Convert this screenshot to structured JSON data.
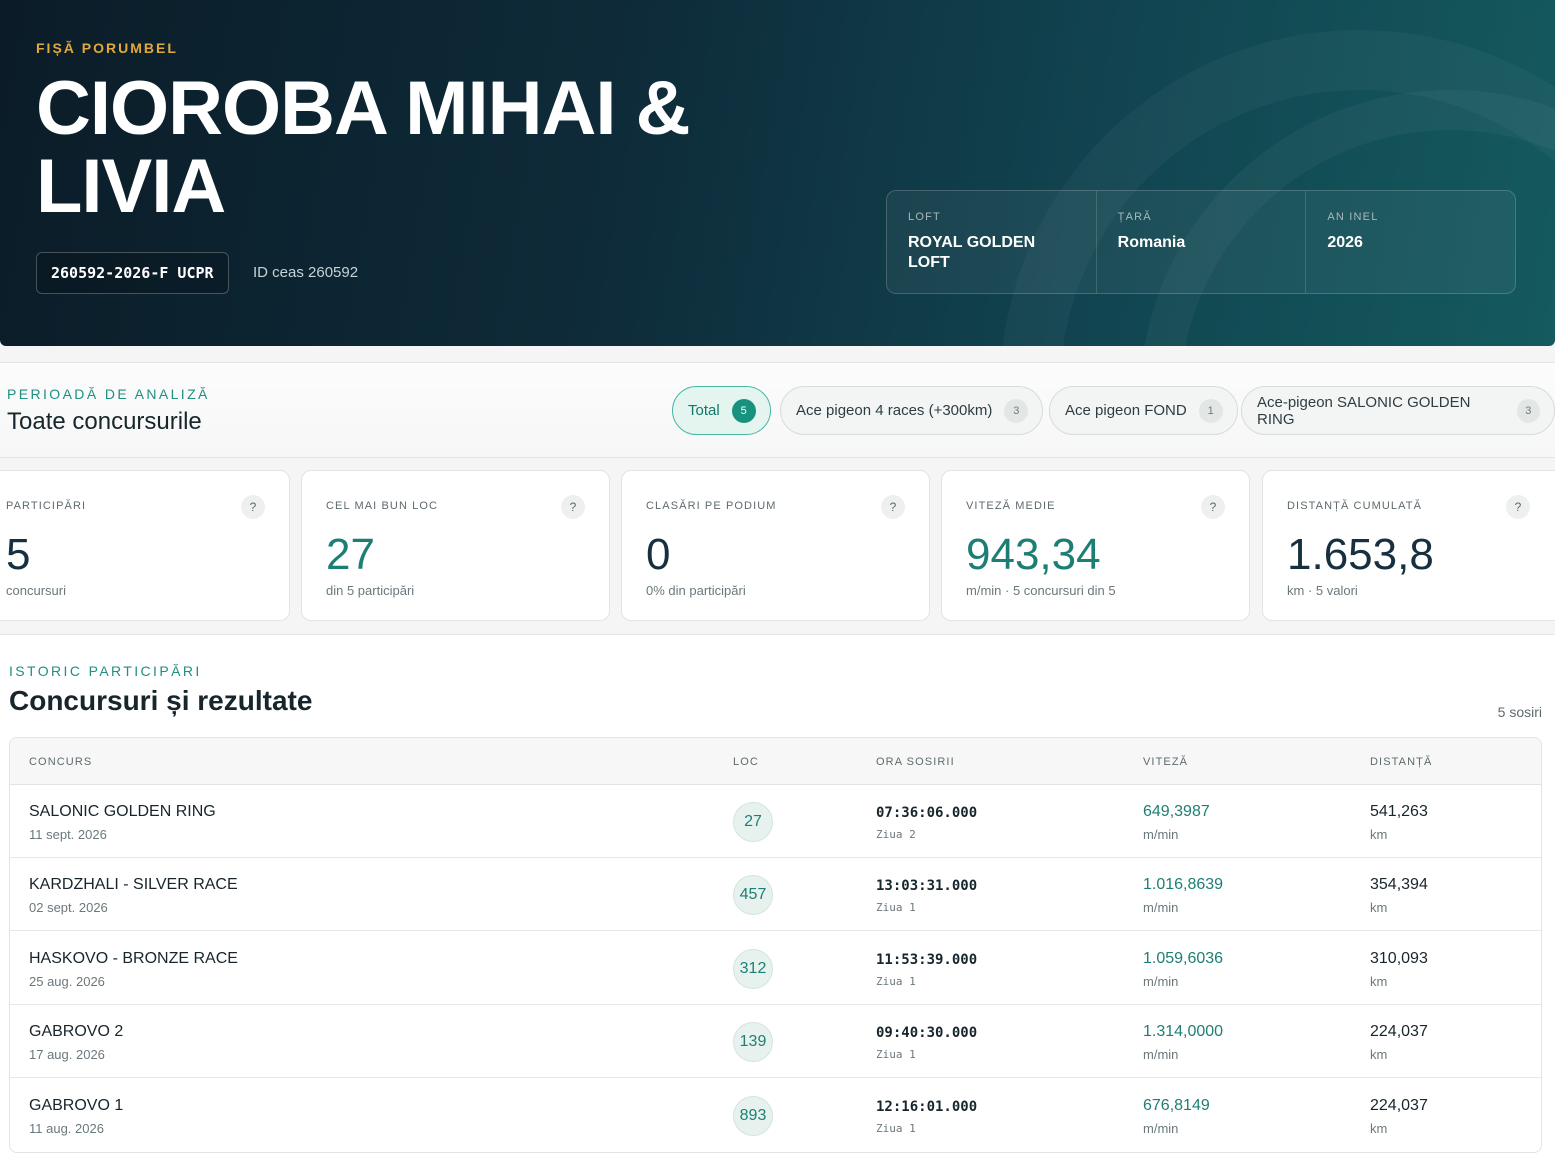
{
  "hero": {
    "eyebrow": "FIȘĂ PORUMBEL",
    "title": "CIOROBA MIHAI & LIVIA",
    "ring": "260592-2026-F UCPR",
    "clock_id": "ID ceas 260592",
    "meta": [
      {
        "label": "LOFT",
        "value": "ROYAL GOLDEN LOFT"
      },
      {
        "label": "ȚARĂ",
        "value": "Romania"
      },
      {
        "label": "AN INEL",
        "value": "2026"
      }
    ]
  },
  "period": {
    "eyebrow": "PERIOADĂ DE ANALIZĂ",
    "title": "Toate concursurile",
    "chips": [
      {
        "label": "Total",
        "count": "5",
        "active": true
      },
      {
        "label": "Ace pigeon 4 races (+300km)",
        "count": "3",
        "active": false
      },
      {
        "label": "Ace pigeon FOND",
        "count": "1",
        "active": false
      },
      {
        "label": "Ace-pigeon SALONIC GOLDEN RING",
        "count": "3",
        "active": false
      }
    ]
  },
  "stats": [
    {
      "label": "PARTICIPĂRI",
      "value": "5",
      "sub": "concursuri",
      "help": "?"
    },
    {
      "label": "CEL MAI BUN LOC",
      "value": "27",
      "sub": "din 5 participări",
      "help": "?"
    },
    {
      "label": "CLASĂRI PE PODIUM",
      "value": "0",
      "sub": "0% din participări",
      "help": "?"
    },
    {
      "label": "VITEZĂ MEDIE",
      "value": "943,34",
      "sub": "m/min · 5 concursuri din 5",
      "help": "?"
    },
    {
      "label": "DISTANȚĂ CUMULATĂ",
      "value": "1.653,8",
      "sub": "km · 5 valori",
      "help": "?"
    }
  ],
  "history": {
    "eyebrow": "ISTORIC PARTICIPĂRI",
    "title": "Concursuri și rezultate",
    "count": "5 sosiri",
    "columns": [
      "CONCURS",
      "LOC",
      "ORA SOSIRII",
      "VITEZĂ",
      "DISTANȚĂ"
    ],
    "rows": [
      {
        "name": "SALONIC GOLDEN RING",
        "date": "11 sept. 2026",
        "loc": "27",
        "time": "07:36:06.000",
        "day": "Ziua 2",
        "speed": "649,3987",
        "speed_unit": "m/min",
        "dist": "541,263",
        "dist_unit": "km"
      },
      {
        "name": "KARDZHALI - SILVER RACE",
        "date": "02 sept. 2026",
        "loc": "457",
        "time": "13:03:31.000",
        "day": "Ziua 1",
        "speed": "1.016,8639",
        "speed_unit": "m/min",
        "dist": "354,394",
        "dist_unit": "km"
      },
      {
        "name": "HASKOVO - BRONZE RACE",
        "date": "25 aug. 2026",
        "loc": "312",
        "time": "11:53:39.000",
        "day": "Ziua 1",
        "speed": "1.059,6036",
        "speed_unit": "m/min",
        "dist": "310,093",
        "dist_unit": "km"
      },
      {
        "name": "GABROVO 2",
        "date": "17 aug. 2026",
        "loc": "139",
        "time": "09:40:30.000",
        "day": "Ziua 1",
        "speed": "1.314,0000",
        "speed_unit": "m/min",
        "dist": "224,037",
        "dist_unit": "km"
      },
      {
        "name": "GABROVO 1",
        "date": "11 aug. 2026",
        "loc": "893",
        "time": "12:16:01.000",
        "day": "Ziua 1",
        "speed": "676,8149",
        "speed_unit": "m/min",
        "dist": "224,037",
        "dist_unit": "km"
      }
    ]
  }
}
